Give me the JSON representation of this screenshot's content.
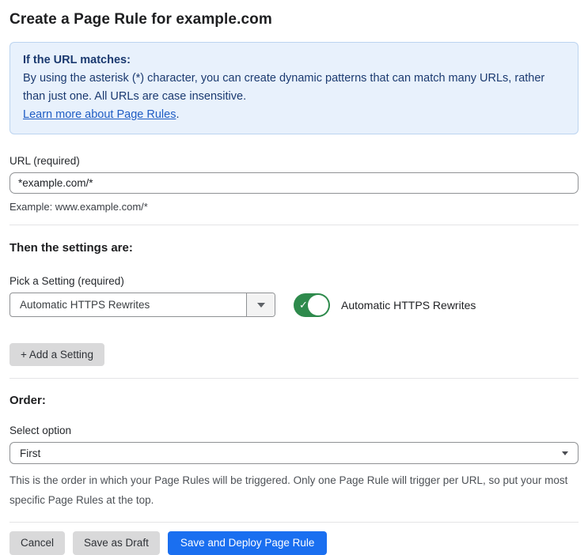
{
  "page": {
    "title": "Create a Page Rule for example.com"
  },
  "info_box": {
    "heading": "If the URL matches:",
    "body": "By using the asterisk (*) character, you can create dynamic patterns that can match many URLs, rather than just one. All URLs are case insensitive.",
    "link_label": "Learn more about Page Rules",
    "link_suffix": "."
  },
  "url_field": {
    "label": "URL (required)",
    "value": "*example.com/*",
    "example": "Example: www.example.com/*"
  },
  "settings_section": {
    "heading": "Then the settings are:",
    "pick_label": "Pick a Setting (required)",
    "dropdown_value": "Automatic HTTPS Rewrites",
    "toggle_state": "on",
    "toggle_check": "✓",
    "toggle_label": "Automatic HTTPS Rewrites",
    "add_setting_label": "+ Add a Setting"
  },
  "order_section": {
    "heading": "Order:",
    "select_label": "Select option",
    "select_value": "First",
    "help_text": "This is the order in which your Page Rules will be triggered. Only one Page Rule will trigger per URL, so put your most specific Page Rules at the top."
  },
  "actions": {
    "cancel_label": "Cancel",
    "save_draft_label": "Save as Draft",
    "deploy_label": "Save and Deploy Page Rule"
  },
  "colors": {
    "accent_blue": "#1a6ff0",
    "toggle_green": "#2e8a4c",
    "info_bg": "#e8f1fc",
    "info_border": "#bcd4f0",
    "info_text": "#1b3a70",
    "link_blue": "#1f5dc4"
  }
}
